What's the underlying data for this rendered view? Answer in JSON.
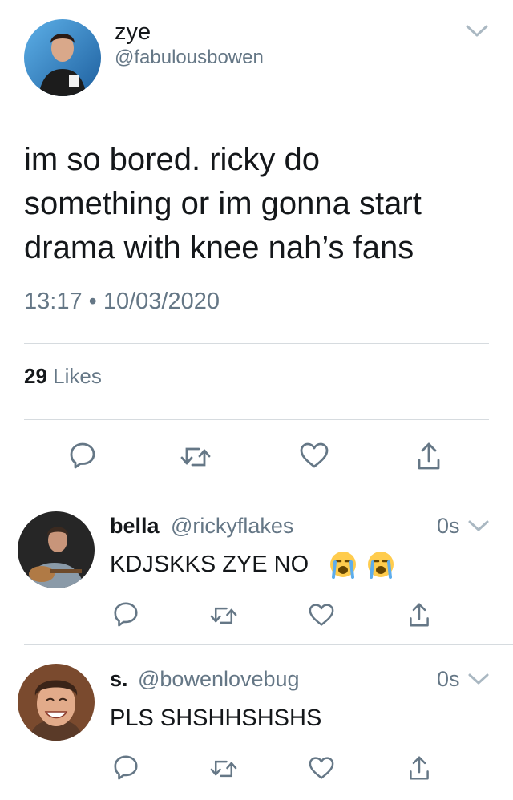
{
  "main_tweet": {
    "display_name": "zye",
    "handle": "@fabulousbowen",
    "text_lines": [
      "im so bored. ricky do",
      "something or im gonna start",
      "drama with knee nah’s fans"
    ],
    "time": "13:17",
    "separator": "•",
    "date": "10/03/2020",
    "likes_count": "29",
    "likes_label": "Likes",
    "avatar_icon": "profile-photo"
  },
  "replies": [
    {
      "display_name": "bella",
      "handle": "@rickyflakes",
      "time": "0s",
      "text": "KDJSKKS ZYE NO",
      "emojis": [
        "loudly-crying-face",
        "loudly-crying-face"
      ],
      "avatar_icon": "profile-photo"
    },
    {
      "display_name": "s.",
      "handle": "@bowenlovebug",
      "time": "0s",
      "text": "PLS SHSHHSHSHS",
      "avatar_icon": "profile-photo"
    }
  ],
  "actions": [
    "reply-icon",
    "retweet-icon",
    "like-icon",
    "share-icon"
  ],
  "colors": {
    "text": "#14171a",
    "secondary": "#657786",
    "divider": "#d6dbdf"
  }
}
